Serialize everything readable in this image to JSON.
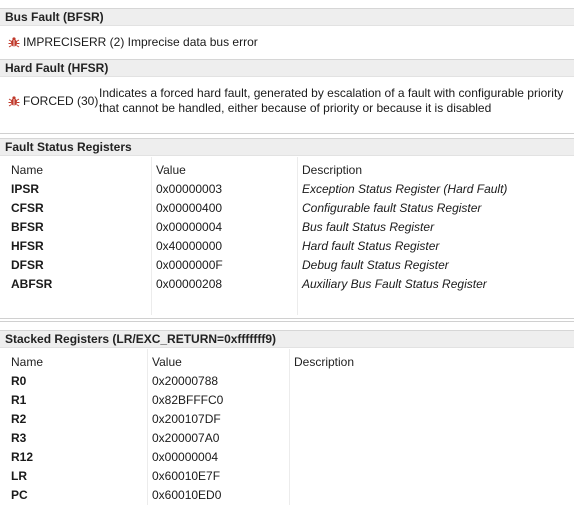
{
  "bus_fault": {
    "title": "Bus Fault (BFSR)",
    "entry": "IMPRECISERR (2) Imprecise data bus error"
  },
  "hard_fault": {
    "title": "Hard Fault (HFSR)",
    "lead": "FORCED (30)",
    "desc": "Indicates a forced hard fault, generated by escalation of a fault with configurable priority that cannot be handled, either because of priority or because it is disabled"
  },
  "fault_regs": {
    "title": "Fault Status Registers",
    "headers": [
      "Name",
      "Value",
      "Description"
    ],
    "rows": [
      {
        "name": "IPSR",
        "value": "0x00000003",
        "desc": "Exception Status Register (Hard Fault)"
      },
      {
        "name": "CFSR",
        "value": "0x00000400",
        "desc": "Configurable fault Status Register"
      },
      {
        "name": "BFSR",
        "value": "0x00000004",
        "desc": "Bus fault Status Register"
      },
      {
        "name": "HFSR",
        "value": "0x40000000",
        "desc": "Hard fault Status Register"
      },
      {
        "name": "DFSR",
        "value": "0x0000000F",
        "desc": "Debug fault Status Register"
      },
      {
        "name": "ABFSR",
        "value": "0x00000208",
        "desc": "Auxiliary Bus Fault Status Register"
      }
    ]
  },
  "stacked_regs": {
    "title": "Stacked Registers (LR/EXC_RETURN=0xfffffff9)",
    "headers": [
      "Name",
      "Value",
      "Description"
    ],
    "rows": [
      {
        "name": "R0",
        "value": "0x20000788"
      },
      {
        "name": "R1",
        "value": "0x82BFFFC0"
      },
      {
        "name": "R2",
        "value": "0x200107DF"
      },
      {
        "name": "R3",
        "value": "0x200007A0"
      },
      {
        "name": "R12",
        "value": "0x00000004"
      },
      {
        "name": "LR",
        "value": "0x60010E7F"
      },
      {
        "name": "PC",
        "value": "0x60010ED0"
      }
    ]
  },
  "icon_color": "#c0392b"
}
